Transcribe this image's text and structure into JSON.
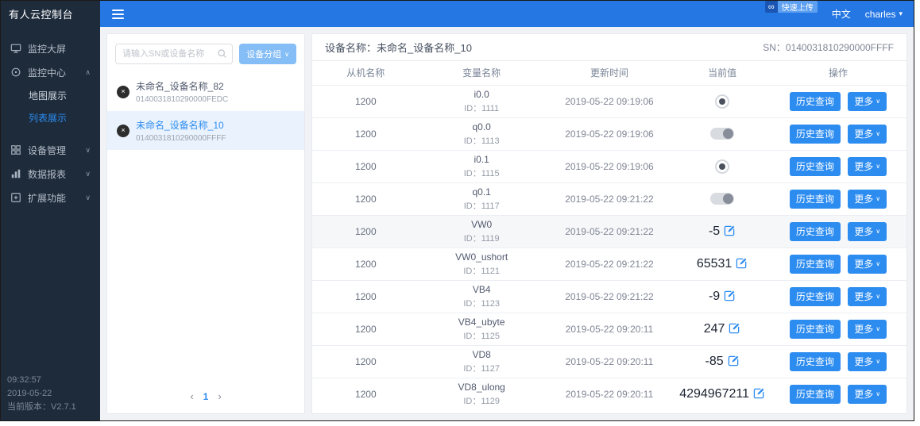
{
  "colors": {
    "accent": "#2d8cf0",
    "topbar_bg": "#2577e3",
    "sidebar_bg": "#1d2b3b"
  },
  "icons": {
    "chevron_down": "∨",
    "chevron_up": "∧",
    "caret_down": "▾",
    "close": "×",
    "infinity": "∞",
    "page_prev": "‹",
    "page_next": "›"
  },
  "topbar": {
    "title": "有人云控制台",
    "badge": "快速上传",
    "lang": "中文",
    "user": "charles"
  },
  "sidebar": {
    "items": [
      {
        "label": "监控大屏"
      },
      {
        "label": "监控中心"
      },
      {
        "label": "地图展示"
      },
      {
        "label": "列表展示"
      },
      {
        "label": "设备管理"
      },
      {
        "label": "数据报表"
      },
      {
        "label": "扩展功能"
      }
    ],
    "footer": {
      "time": "09:32:57",
      "date": "2019-05-22",
      "version": "当前版本：V2.7.1"
    }
  },
  "device_panel": {
    "search_placeholder": "请输入SN或设备名称",
    "group_button": "设备分组",
    "devices": [
      {
        "name": "未命名_设备名称_82",
        "sn": "0140031810290000FEDC",
        "status": "offline"
      },
      {
        "name": "未命名_设备名称_10",
        "sn": "0140031810290000FFFF",
        "status": "offline"
      }
    ],
    "pagination": {
      "page": "1"
    }
  },
  "detail": {
    "title": "设备名称：未命名_设备名称_10",
    "sn": "SN：0140031810290000FFFF",
    "headers": [
      "从机名称",
      "变量名称",
      "更新时间",
      "当前值",
      "操作"
    ],
    "actions": {
      "history": "历史查询",
      "more": "更多"
    },
    "rows": [
      {
        "slave": "1200",
        "var": "i0.0",
        "id": "ID：1111",
        "time": "2019-05-22 09:19:06",
        "value_type": "indicator"
      },
      {
        "slave": "1200",
        "var": "q0.0",
        "id": "ID：1113",
        "time": "2019-05-22 09:19:06",
        "value_type": "switch"
      },
      {
        "slave": "1200",
        "var": "i0.1",
        "id": "ID：1115",
        "time": "2019-05-22 09:19:06",
        "value_type": "indicator"
      },
      {
        "slave": "1200",
        "var": "q0.1",
        "id": "ID：1117",
        "time": "2019-05-22 09:21:22",
        "value_type": "switch"
      },
      {
        "slave": "1200",
        "var": "VW0",
        "id": "ID：1119",
        "time": "2019-05-22 09:21:22",
        "value_type": "number",
        "value": "-5"
      },
      {
        "slave": "1200",
        "var": "VW0_ushort",
        "id": "ID：1121",
        "time": "2019-05-22 09:21:22",
        "value_type": "number",
        "value": "65531"
      },
      {
        "slave": "1200",
        "var": "VB4",
        "id": "ID：1123",
        "time": "2019-05-22 09:21:22",
        "value_type": "number",
        "value": "-9"
      },
      {
        "slave": "1200",
        "var": "VB4_ubyte",
        "id": "ID：1125",
        "time": "2019-05-22 09:20:11",
        "value_type": "number",
        "value": "247"
      },
      {
        "slave": "1200",
        "var": "VD8",
        "id": "ID：1127",
        "time": "2019-05-22 09:20:11",
        "value_type": "number",
        "value": "-85"
      },
      {
        "slave": "1200",
        "var": "VD8_ulong",
        "id": "ID：1129",
        "time": "2019-05-22 09:20:11",
        "value_type": "number",
        "value": "4294967211"
      }
    ]
  }
}
